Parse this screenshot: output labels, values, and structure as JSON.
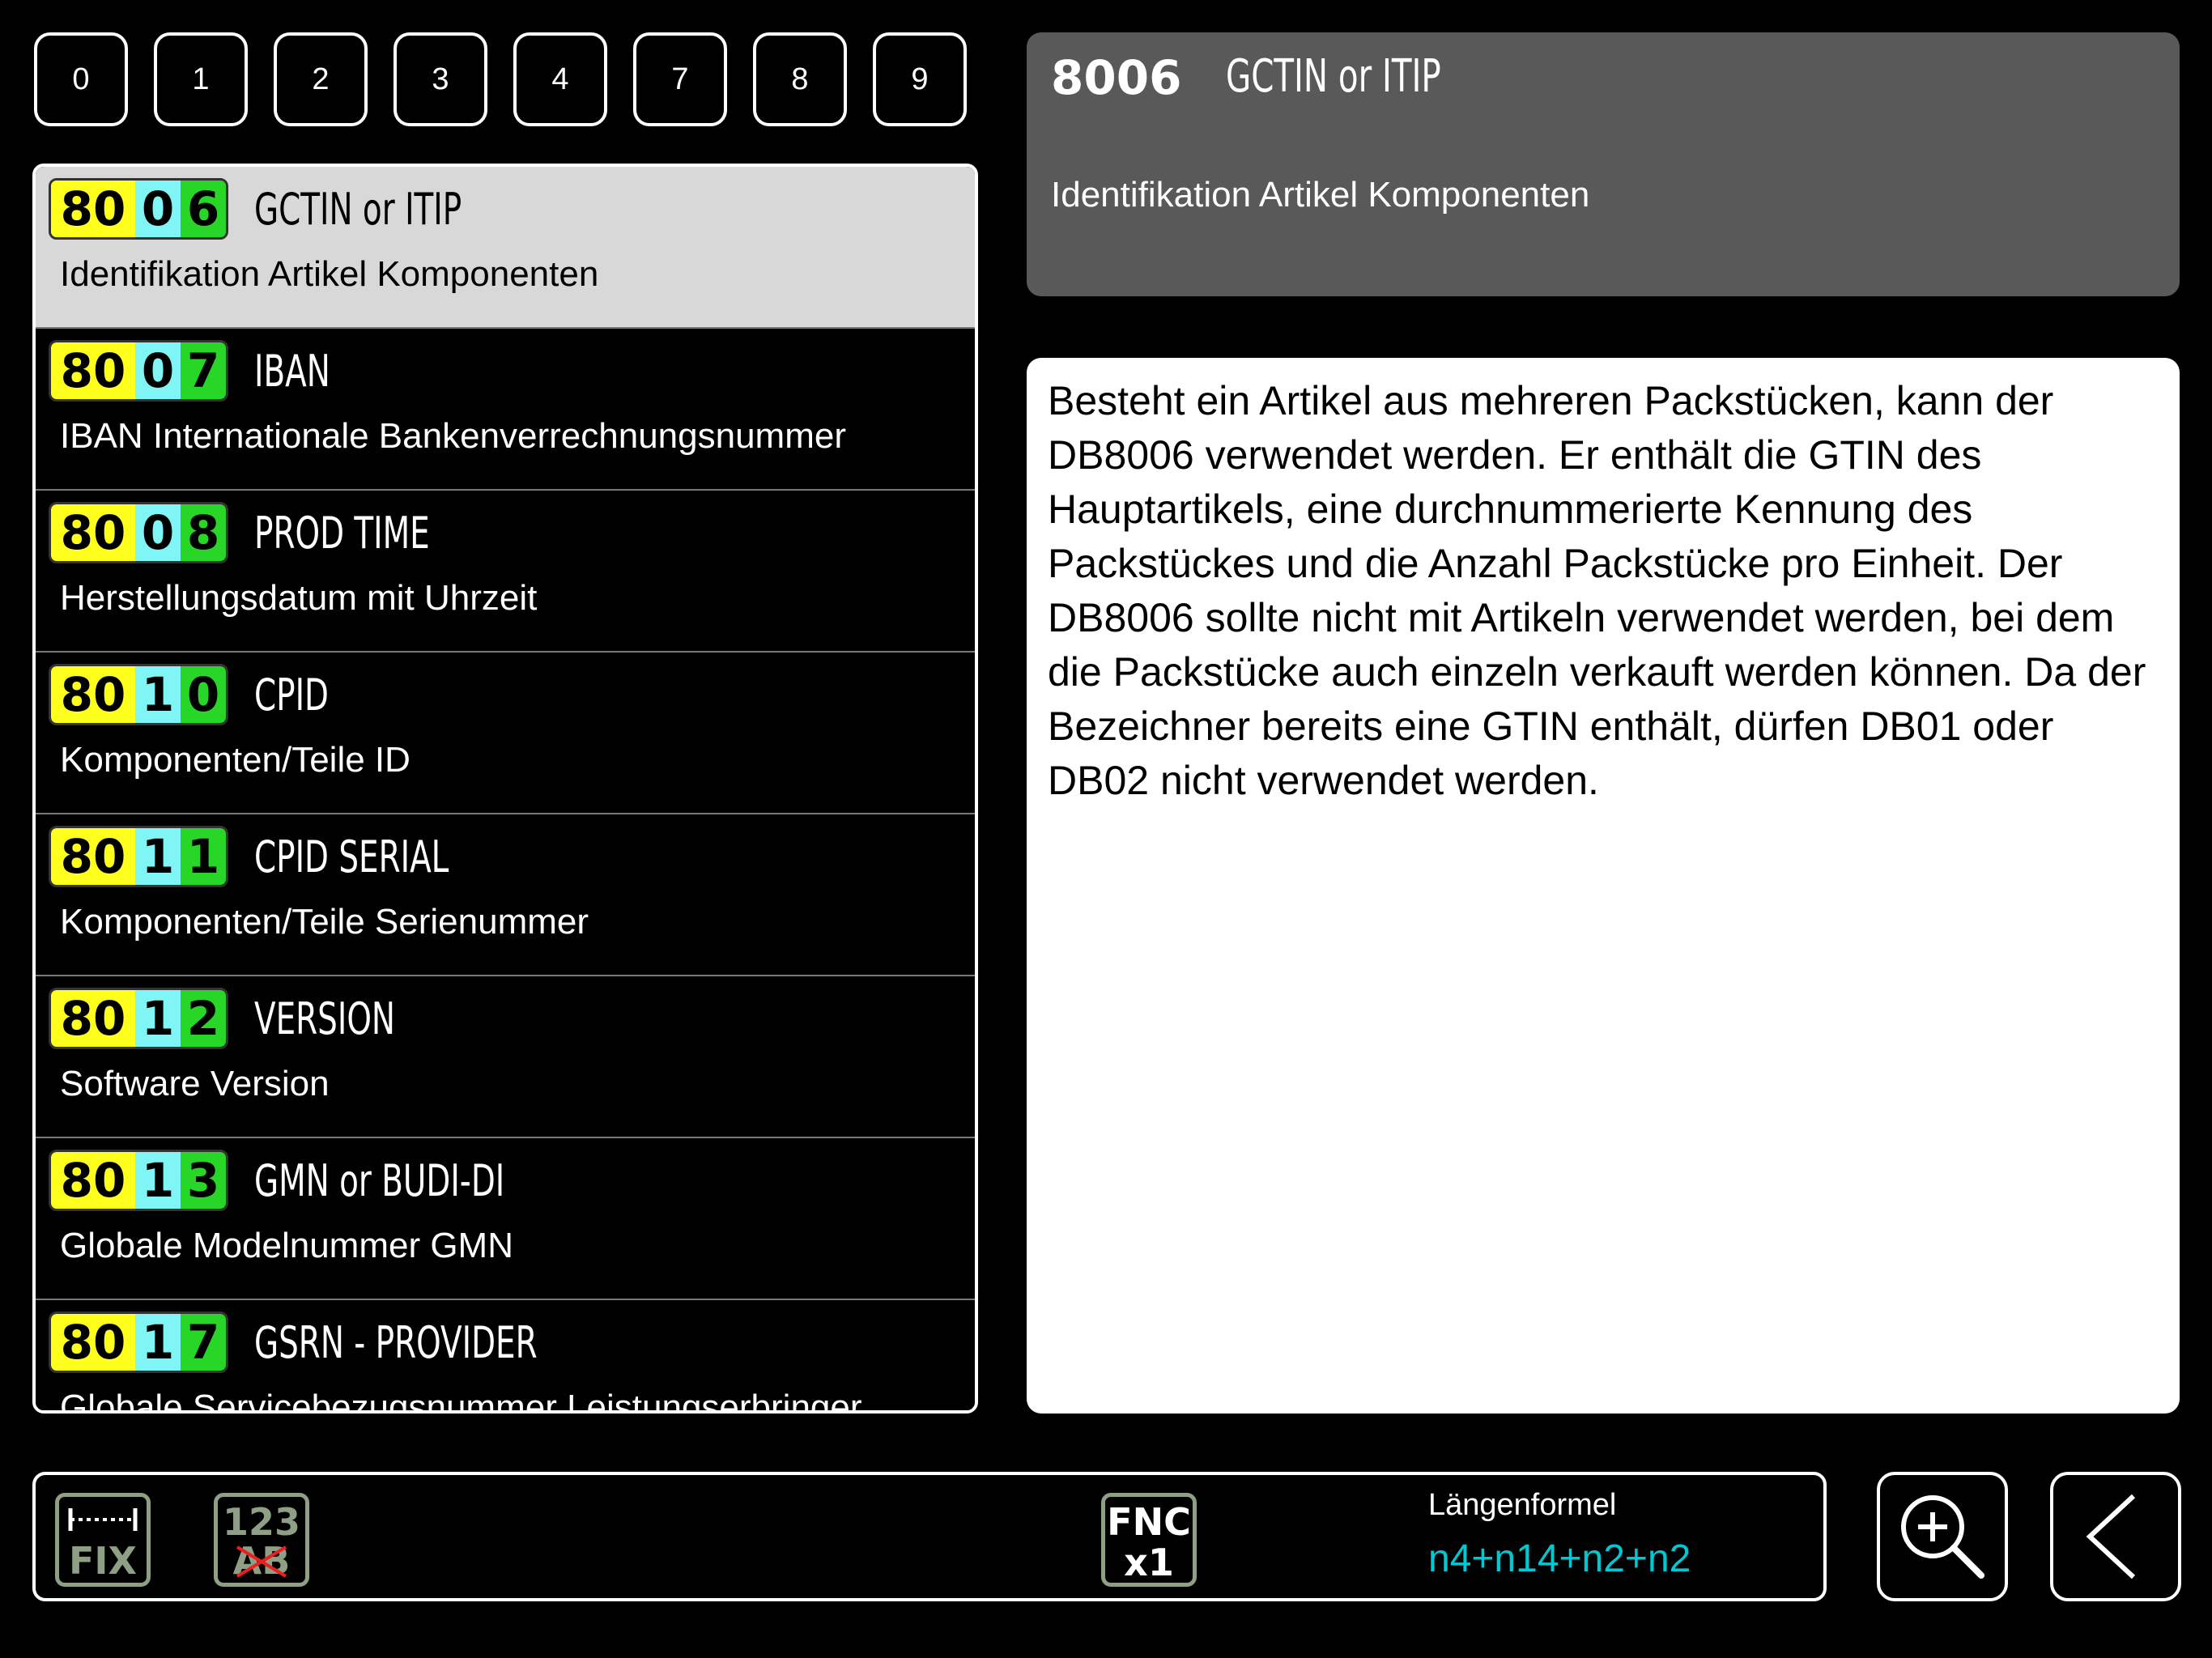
{
  "digit_filter": [
    "0",
    "1",
    "2",
    "3",
    "4",
    "7",
    "8",
    "9"
  ],
  "items": [
    {
      "code_a": "80",
      "code_b": "0",
      "code_c": "6",
      "title": "GCTIN or ITIP",
      "desc": "Identifikation Artikel Komponenten",
      "selected": true
    },
    {
      "code_a": "80",
      "code_b": "0",
      "code_c": "7",
      "title": "IBAN",
      "desc": "IBAN Internationale Bankenverrechnungsnummer"
    },
    {
      "code_a": "80",
      "code_b": "0",
      "code_c": "8",
      "title": "PROD TIME",
      "desc": "Herstellungsdatum mit Uhrzeit"
    },
    {
      "code_a": "80",
      "code_b": "1",
      "code_c": "0",
      "title": "CPID",
      "desc": "Komponenten/Teile ID"
    },
    {
      "code_a": "80",
      "code_b": "1",
      "code_c": "1",
      "title": "CPID SERIAL",
      "desc": "Komponenten/Teile Serienummer"
    },
    {
      "code_a": "80",
      "code_b": "1",
      "code_c": "2",
      "title": "VERSION",
      "desc": "Software Version"
    },
    {
      "code_a": "80",
      "code_b": "1",
      "code_c": "3",
      "title": "GMN or BUDI-DI",
      "desc": "Globale Modelnummer GMN"
    },
    {
      "code_a": "80",
      "code_b": "1",
      "code_c": "7",
      "title": "GSRN - PROVIDER",
      "desc": "Globale Servicebezugsnummer Leistungserbringer"
    }
  ],
  "detail": {
    "code": "8006",
    "name": "GCTIN or ITIP",
    "subtitle": "Identifikation Artikel Komponenten",
    "body": "Besteht ein Artikel aus mehreren Packstücken, kann der DB8006 verwendet werden. Er enthält die GTIN des Hauptartikels, eine durchnummerierte Kennung des Packstückes und die Anzahl Packstücke pro Einheit. Der DB8006 sollte nicht mit Artikeln verwendet werden, bei dem die Packstücke auch einzeln verkauft werden können. Da der Bezeichner bereits eine GTIN enthält, dürfen DB01 oder DB02 nicht verwendet werden."
  },
  "toolbar": {
    "fix_label": "FIX",
    "num_label": "123",
    "alpha_label": "AB",
    "fnc_line1": "FNC",
    "fnc_line2": "x1",
    "length_label": "Längenformel",
    "length_value": "n4+n14+n2+n2"
  },
  "colors": {
    "code_segment_a": "#ffff1e",
    "code_segment_b": "#7ff5f5",
    "code_segment_c": "#28d628",
    "selected_row": "#d8d8d8",
    "header_panel": "#595959",
    "length_value": "#00c8d2",
    "disabled_icon": "#8f9f86"
  },
  "icons": {
    "zoom": "zoom-in-icon",
    "back": "back-chevron-icon"
  }
}
